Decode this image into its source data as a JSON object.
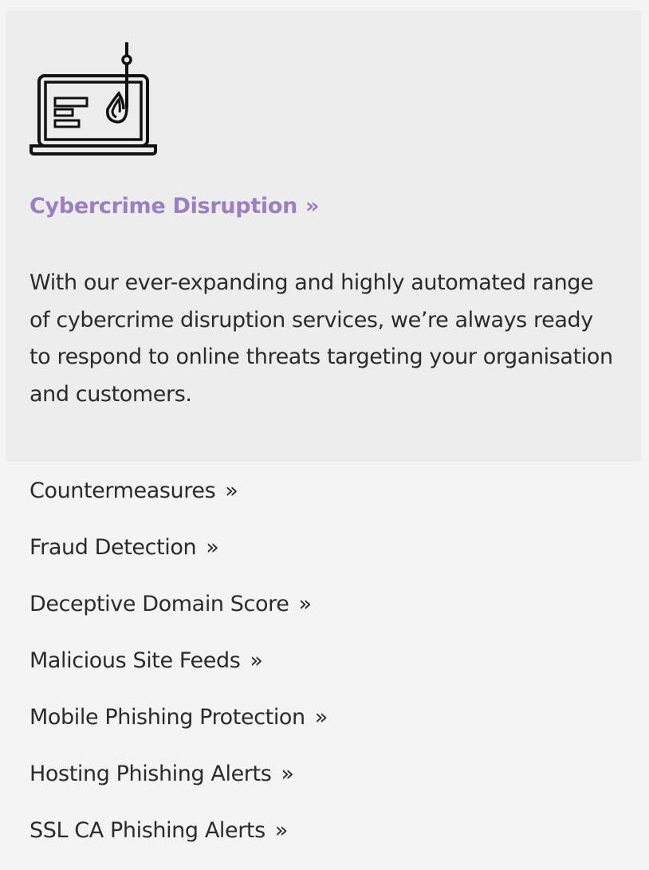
{
  "feature": {
    "icon": "laptop-phishing-hook-icon",
    "title": "Cybercrime Disruption",
    "title_chevron": "»",
    "title_color": "#9b7fc0",
    "description": "With our ever-expanding and highly automated range of cybercrime disruption services, we’re always ready to respond to online threats targeting your organisation and customers."
  },
  "links": [
    {
      "label": "Countermeasures",
      "chevron": "»"
    },
    {
      "label": "Fraud Detection",
      "chevron": "»"
    },
    {
      "label": "Deceptive Domain Score",
      "chevron": "»"
    },
    {
      "label": "Malicious Site Feeds",
      "chevron": "»"
    },
    {
      "label": "Mobile Phishing Protection",
      "chevron": "»"
    },
    {
      "label": "Hosting Phishing Alerts",
      "chevron": "»"
    },
    {
      "label": "SSL CA Phishing Alerts",
      "chevron": "»"
    }
  ]
}
